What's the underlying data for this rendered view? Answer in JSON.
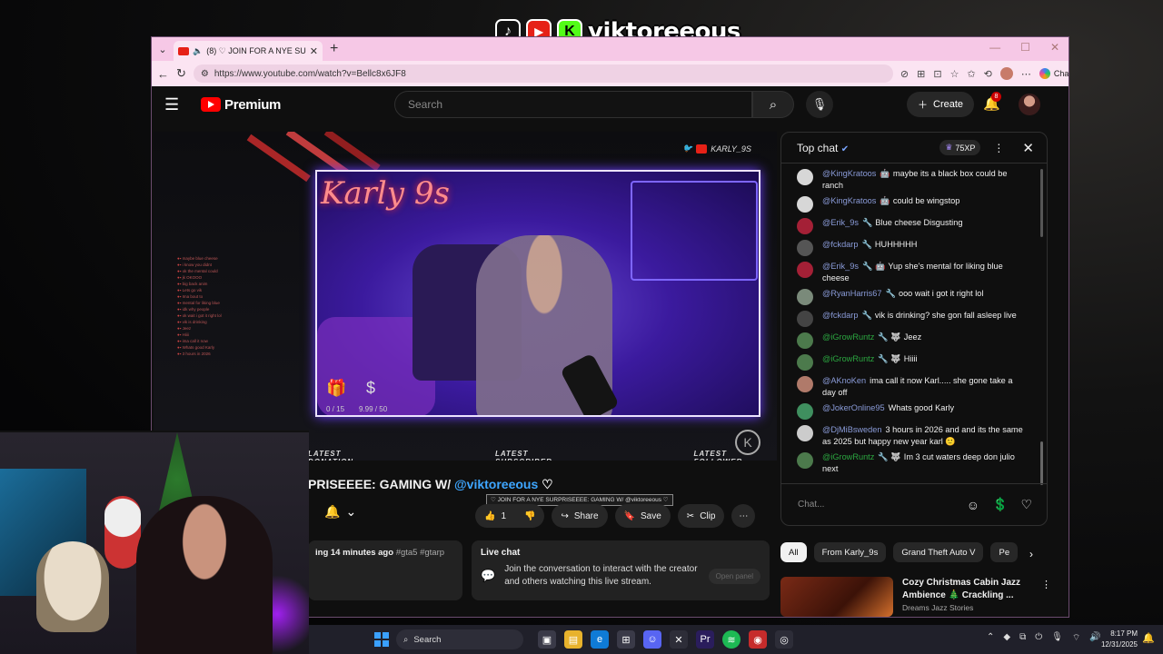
{
  "overlay": {
    "brand_name": "viktoreeous",
    "icons": [
      "tiktok-icon",
      "youtube-icon",
      "kick-icon"
    ]
  },
  "browser": {
    "tab_title": "(8) ♡ JOIN FOR A NYE SURPRISEEEE: GAMING W/ @viktoreeous ♡",
    "url": "https://www.youtube.com/watch?v=Bellc8x6JF8",
    "chat_label": "Chat"
  },
  "youtube": {
    "logo_text": "Premium",
    "search_placeholder": "Search",
    "create_label": "Create",
    "notif_count": "8"
  },
  "player": {
    "neon_sign": "Karly 9s",
    "handle": "KARLY_9S",
    "counter_left": "0 / 15",
    "counter_right": "9.99 / 50",
    "overlay_labels": [
      "LATEST DONATION",
      "LATEST SUBSCRIBER",
      "LATEST FOLLOWER"
    ],
    "mini_chat": [
      "maybe blue cheese",
      "i know you didnt",
      "ok the mental could",
      "jk OKOOO",
      "big back anim",
      "Lets go vik",
      "Ima bout to",
      "mental for liking blue",
      "idk why people",
      "ok wait i got it right lol",
      "vik is drinking",
      "Jeez",
      "Hiiii",
      "ima call it now",
      "Whats good Karly",
      "3 hours in 2026"
    ]
  },
  "video": {
    "title_prefix": "PRISEEEE: GAMING W/ ",
    "title_mention": "@viktoreeous",
    "title_suffix": " ♡",
    "tooltip": "♡ JOIN FOR A NYE SURPRISEEEE: GAMING W/ @viktoreeous ♡",
    "like_count": "1",
    "share_label": "Share",
    "save_label": "Save",
    "clip_label": "Clip",
    "desc_meta": "ing 14 minutes ago",
    "desc_tags": "#gta5 #gtarp"
  },
  "live_chat_box": {
    "title": "Live chat",
    "text": "Join the conversation to interact with the creator and others watching this live stream.",
    "button": "Open panel"
  },
  "chat": {
    "header": "Top chat",
    "xp": "75XP",
    "input_placeholder": "Chat...",
    "messages": [
      {
        "user": "@KingKratoos",
        "badge": "🤖",
        "text": "maybe its a black box could be ranch",
        "color": "#8a9bd8"
      },
      {
        "user": "@KingKratoos",
        "badge": "🤖",
        "text": "could be wingstop",
        "color": "#8a9bd8"
      },
      {
        "user": "@Erik_9s",
        "badge": "🔧",
        "text": "Blue cheese Disgusting",
        "color": "#8a9bd8"
      },
      {
        "user": "@fckdarp",
        "badge": "🔧",
        "text": "HUHHHHH",
        "color": "#8a9bd8"
      },
      {
        "user": "@Erik_9s",
        "badge": "🔧 🤖",
        "text": "Yup she's mental for liking blue cheese",
        "color": "#8a9bd8"
      },
      {
        "user": "@RyanHarris67",
        "badge": "🔧",
        "text": "ooo wait i got it right lol",
        "color": "#8a9bd8"
      },
      {
        "user": "@fckdarp",
        "badge": "🔧",
        "text": "vik is drinking? she gon fall asleep live",
        "color": "#8a9bd8"
      },
      {
        "user": "@iGrowRuntz",
        "badge": "🔧 🐺",
        "text": "Jeez",
        "color": "#2ba640"
      },
      {
        "user": "@iGrowRuntz",
        "badge": "🔧 🐺",
        "text": "Hiiii",
        "color": "#2ba640"
      },
      {
        "user": "@AKnoKen",
        "badge": "",
        "text": "ima call it now Karl..... she gone take a day off",
        "color": "#8a9bd8"
      },
      {
        "user": "@JokerOnline95",
        "badge": "",
        "text": "Whats good Karly",
        "color": "#8a9bd8"
      },
      {
        "user": "@DjMiBsweden",
        "badge": "",
        "text": "3 hours in 2026 and and its the same as 2025 but happy new year karl 🙂",
        "color": "#8a9bd8"
      },
      {
        "user": "@iGrowRuntz",
        "badge": "🔧 🐺",
        "text": "Im 3 cut waters deep don julio next",
        "color": "#2ba640"
      }
    ],
    "avatar_colors": [
      "#d7d7d7",
      "#d7d7d7",
      "#a42036",
      "#555",
      "#a42036",
      "#7a8a7a",
      "#444",
      "#4c7a4c",
      "#4c7a4c",
      "#b07a6a",
      "#3f8f5f",
      "#ccc",
      "#4c7a4c"
    ]
  },
  "sidebar": {
    "chips": [
      "All",
      "From Karly_9s",
      "Grand Theft Auto V",
      "Pe"
    ],
    "rec_title": "Cozy Christmas Cabin Jazz Ambience 🎄 Crackling ...",
    "rec_channel": "Dreams Jazz Stories"
  },
  "taskbar": {
    "search_label": "Search",
    "time": "8:17 PM",
    "date": "12/31/2025"
  }
}
